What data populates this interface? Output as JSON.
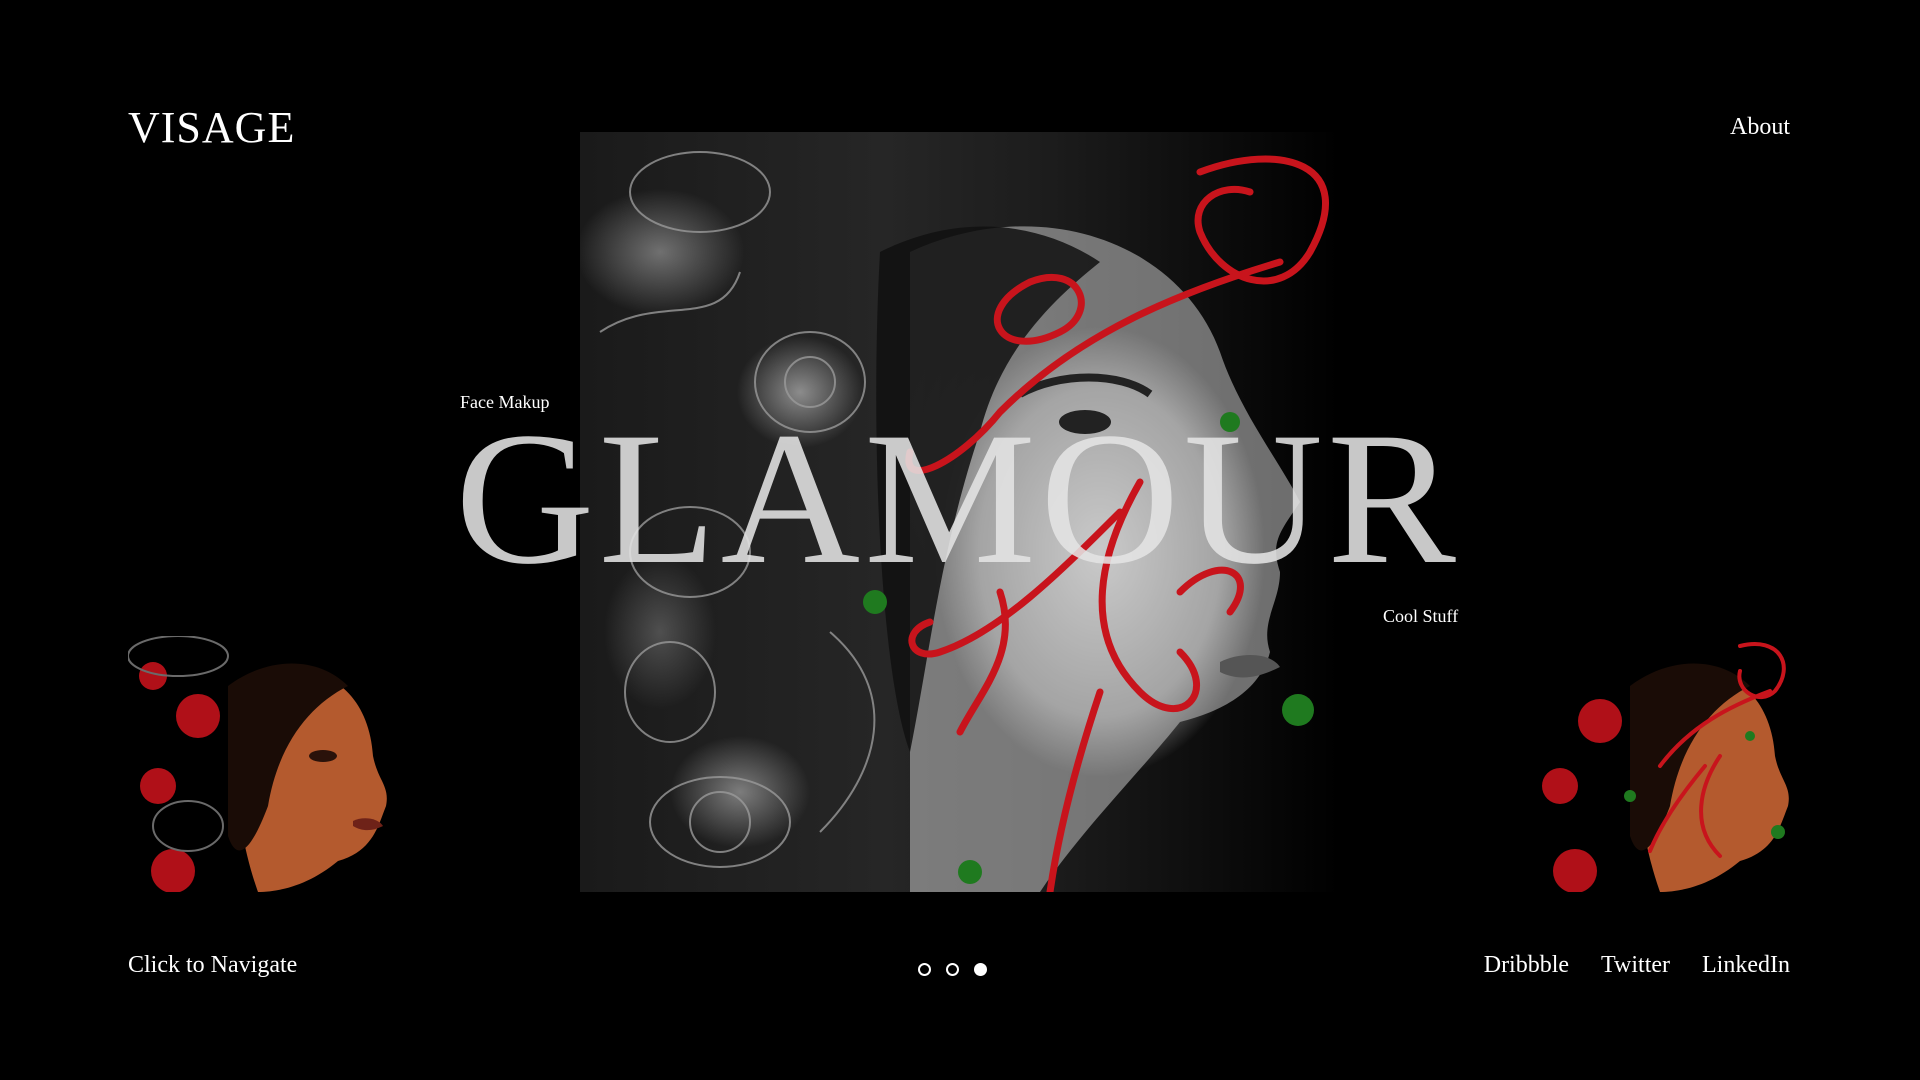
{
  "header": {
    "logo": "VISAGE",
    "nav_about": "About"
  },
  "hero": {
    "tag_left": "Face Makup",
    "title": "GLAMOUR",
    "tag_right": "Cool Stuff",
    "accent_color": "#c8141c",
    "bead_color": "#1f7a1f"
  },
  "footer": {
    "nav_hint": "Click to Navigate",
    "pagination": {
      "total": 3,
      "active_index": 3
    },
    "social": [
      "Dribbble",
      "Twitter",
      "LinkedIn"
    ]
  }
}
